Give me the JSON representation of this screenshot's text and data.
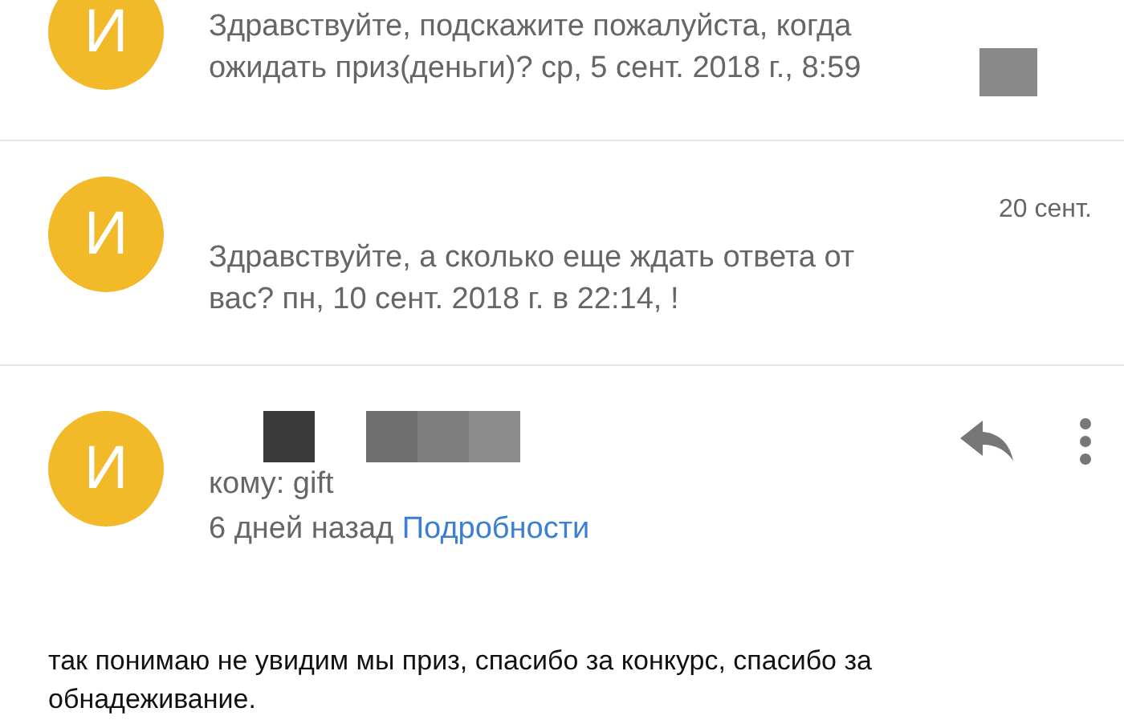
{
  "threads": [
    {
      "avatar": "И",
      "snippet": [
        "Здравствуйте, подскажите пожалуйста, когда",
        "ожидать приз(деньги)? ср, 5 сент. 2018 г., 8:59"
      ],
      "redacted": true,
      "cut_top": true
    },
    {
      "avatar": "И",
      "date": "20 сент.",
      "snippet": [
        "Здравствуйте, а сколько еще ждать ответа от",
        "вас? пн, 10 сент. 2018 г. в 22:14, !"
      ],
      "redacted": false,
      "cut_top": false
    }
  ],
  "open_message": {
    "avatar": "И",
    "recipient": "кому: gift",
    "time": "6 дней назад",
    "details_link": "Подробности",
    "body": "так понимаю не увидим мы приз, спасибо за конкурс, спасибо за обнадеживание."
  }
}
